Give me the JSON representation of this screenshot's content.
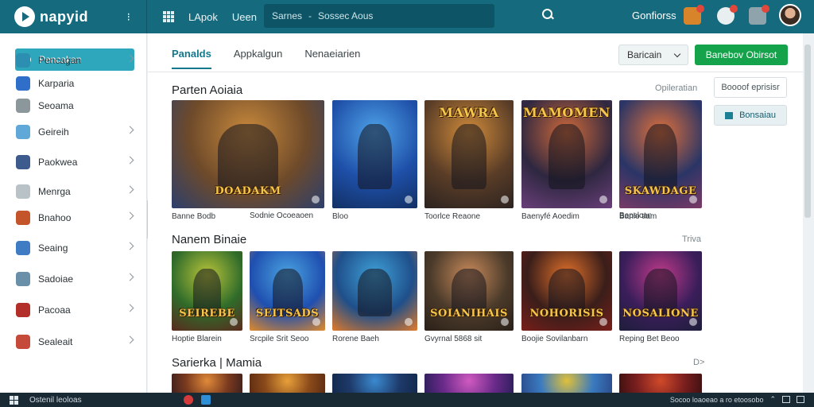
{
  "topbar": {
    "brand": "napyid",
    "more": "⁝",
    "links": [
      "LApok",
      "Ueen"
    ],
    "search_text": "Sarnes",
    "search_sep": "-",
    "search_hint": "Sossec Aous",
    "right_link": "Gonfiorss"
  },
  "sidebar": {
    "search_label": "Pencakan",
    "items": [
      {
        "label": "Pencagan",
        "icon": "refresh-icon",
        "color": "#2c8fb2",
        "chevron": true
      },
      {
        "label": "Karparia",
        "icon": "shield-icon",
        "color": "#2f6fc9",
        "chevron": false
      },
      {
        "label": "Seoama",
        "icon": "gear-icon",
        "color": "#8c979c",
        "chevron": false
      },
      {
        "label": "Geireih",
        "icon": "game-thumb-icon",
        "color": "#5fa8d8",
        "chevron": true
      },
      {
        "label": "Paokwea",
        "icon": "game-thumb-icon",
        "color": "#3d5b8c",
        "chevron": true
      },
      {
        "label": "Menrga",
        "icon": "game-thumb-icon",
        "color": "#b9c2c6",
        "chevron": true
      },
      {
        "label": "Bnahoo",
        "icon": "game-thumb-icon",
        "color": "#c4552b",
        "chevron": true
      },
      {
        "label": "Seaing",
        "icon": "game-thumb-icon",
        "color": "#3f7cc4",
        "chevron": true
      },
      {
        "label": "Sadoiae",
        "icon": "game-thumb-icon",
        "color": "#6a8fa8",
        "chevron": true
      },
      {
        "label": "Pacoaa",
        "icon": "game-thumb-icon",
        "color": "#b3302a",
        "chevron": true
      },
      {
        "label": "Sealeait",
        "icon": "game-thumb-icon",
        "color": "#c54a3a",
        "chevron": true
      }
    ]
  },
  "main": {
    "tabs": [
      "Panalds",
      "Appkalgun",
      "Nenaeiarien"
    ],
    "sort_label": "Baricain",
    "cta_label": "Banebov Obirsot",
    "right_buttons": [
      "Boooof eprisisr",
      "Bonsaiau"
    ],
    "sections": [
      {
        "title": "Parten Aoiaia",
        "more": "Opileratian",
        "cards": [
          {
            "caption": "Banne Bodb",
            "art_title": "DOADAKM",
            "colors": [
              "#6e4a2a",
              "#c98a3c",
              "#2c3f6c"
            ]
          },
          {
            "caption": "Bloo",
            "art_title": "",
            "colors": [
              "#1e4fa8",
              "#4fa3e8",
              "#123063"
            ]
          },
          {
            "caption": "Toorlce Reaone",
            "art_title": "MAWRA",
            "colors": [
              "#5a3d27",
              "#d08b3a",
              "#2b2320"
            ]
          },
          {
            "caption": "Baenyfé Aoedim",
            "art_title": "MAMOMEN",
            "colors": [
              "#2e2740",
              "#d06a3a",
              "#6a3f7a"
            ]
          },
          {
            "caption": "Banlo tiam",
            "art_title": "SKAWDAGE",
            "colors": [
              "#2a3566",
              "#e0703a",
              "#7a3a66"
            ]
          }
        ],
        "card_captions_extra": [
          "Sodnie Ocoeaoen",
          "Bopslcan"
        ]
      },
      {
        "title": "Nanem Binaie",
        "more": "Triva",
        "cards": [
          {
            "caption": "Hoptie Blarein",
            "art_title": "SEIREBE",
            "colors": [
              "#2f6b2a",
              "#b8c43a",
              "#5a2a1e"
            ]
          },
          {
            "caption": "Srcpile Srit Seoo",
            "art_title": "SEITSADS",
            "colors": [
              "#1f4fb0",
              "#4aa3e0",
              "#e08a2a"
            ]
          },
          {
            "caption": "Rorene Baeh",
            "art_title": "",
            "colors": [
              "#1f4f8a",
              "#3fa0d8",
              "#e07a2a"
            ]
          },
          {
            "caption": "Gvyrnal 5868 sit",
            "art_title": "SOIANIHAIS",
            "colors": [
              "#4a3a2a",
              "#c88a5a",
              "#2a2018"
            ]
          },
          {
            "caption": "Boojie Sovilanbarn",
            "art_title": "NOHORISIS",
            "colors": [
              "#3a1e1a",
              "#e0702a",
              "#7a1e1a"
            ]
          },
          {
            "caption": "Reping Bet Beoo",
            "art_title": "NOSALIONE",
            "colors": [
              "#3a1e5a",
              "#c03a8a",
              "#1e1e3a"
            ]
          }
        ]
      },
      {
        "title": "Sarierka | Mamia",
        "more": "D>",
        "cards": [
          {
            "caption": "",
            "art_title": "",
            "colors": [
              "#7a3a1e",
              "#e08a3a",
              "#3a1e1e"
            ]
          },
          {
            "caption": "",
            "art_title": "",
            "colors": [
              "#8a4a1a",
              "#e8a03a",
              "#5a2a12"
            ]
          },
          {
            "caption": "",
            "art_title": "",
            "colors": [
              "#1e3a6a",
              "#3a8ad0",
              "#12284a"
            ]
          },
          {
            "caption": "",
            "art_title": "",
            "colors": [
              "#6a2a8a",
              "#d05ac0",
              "#2a1e5a"
            ]
          },
          {
            "caption": "",
            "art_title": "",
            "colors": [
              "#3a7ac0",
              "#e0c03a",
              "#2a4a8a"
            ]
          },
          {
            "caption": "",
            "art_title": "",
            "colors": [
              "#7a1e1e",
              "#d04a2a",
              "#3a1010"
            ]
          }
        ]
      }
    ]
  },
  "taskbar": {
    "text": "Ostenil leoloas",
    "tray_text": "Socoo loaoeao a ro etoosobo"
  },
  "colors": {
    "topbar": "#166a7d",
    "accent": "#14788d",
    "cta": "#14a34b",
    "sidebar_search": "#2ea7bd"
  }
}
